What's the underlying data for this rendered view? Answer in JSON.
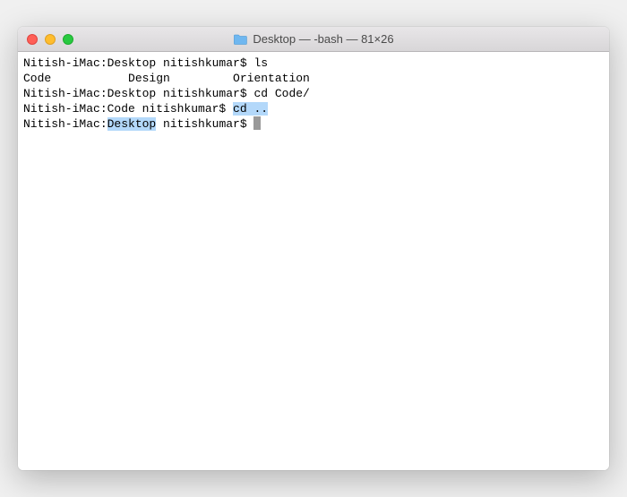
{
  "window": {
    "title": "Desktop — -bash — 81×26"
  },
  "terminal": {
    "line1_prompt": "Nitish-iMac:Desktop nitishkumar$ ",
    "line1_cmd": "ls",
    "line2_output": "Code           Design         Orientation",
    "line3_prompt": "Nitish-iMac:Desktop nitishkumar$ ",
    "line3_cmd": "cd Code/",
    "line4_prompt": "Nitish-iMac:Code nitishkumar$ ",
    "line4_cmd": "cd ..",
    "line5_prefix": "Nitish-iMac:",
    "line5_highlight": "Desktop",
    "line5_suffix": " nitishkumar$ "
  }
}
